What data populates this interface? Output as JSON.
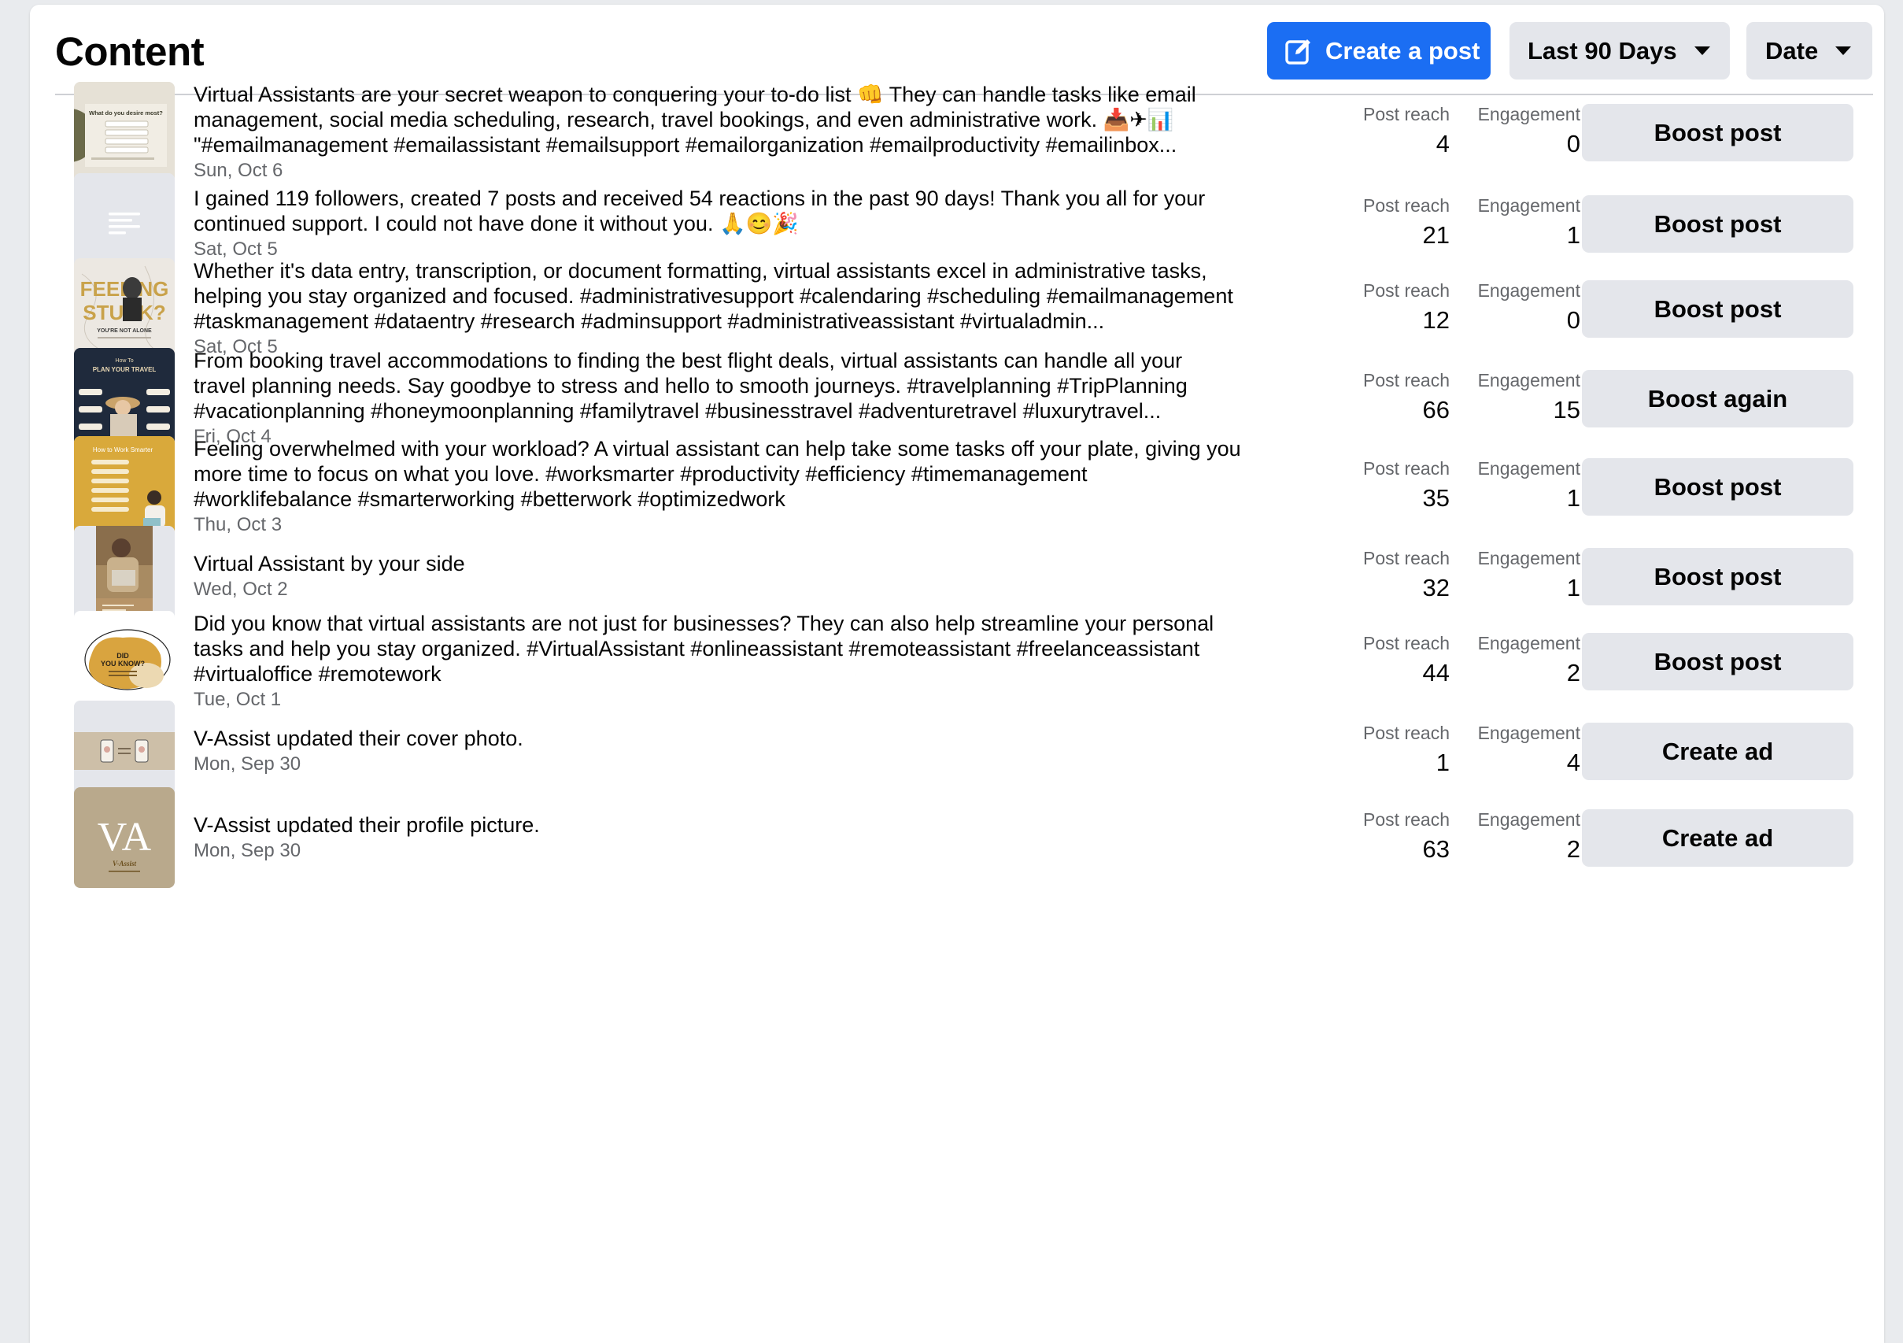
{
  "header": {
    "title": "Content",
    "create_label": "Create a post",
    "range_label": "Last 90 Days",
    "sort_label": "Date"
  },
  "colors": {
    "primary": "#1b6ef3",
    "secondary_button": "#e4e6eb",
    "muted_text": "#65676b"
  },
  "metric_labels": {
    "reach": "Post reach",
    "engagement": "Engagement"
  },
  "posts": [
    {
      "lines": [
        "Virtual Assistants are your secret weapon to conquering your to-do list 👊 They can handle tasks like email",
        "management, social media scheduling, research, travel bookings, and even administrative work. 📥✈📊",
        "\"#emailmanagement #emailassistant #emailsupport #emailorganization #emailproductivity #emailinbox..."
      ],
      "date": "Sun, Oct 6",
      "reach": "4",
      "engagement": "0",
      "action": "Boost post",
      "thumbnail": "email-tasks-graphic",
      "thumb_text": "What do you desire most?"
    },
    {
      "lines": [
        "I gained 119 followers, created 7 posts and received 54 reactions in the past 90 days! Thank you all for your",
        "continued support. I could not have done it without you. 🙏😊🎉"
      ],
      "date": "Sat, Oct 5",
      "reach": "21",
      "engagement": "1",
      "action": "Boost post",
      "thumbnail": "text-post-icon",
      "thumb_text": ""
    },
    {
      "lines": [
        "Whether it's data entry, transcription, or document formatting, virtual assistants excel in administrative tasks,",
        "helping you stay organized and focused. #administrativesupport #calendaring #scheduling #emailmanagement",
        "#taskmanagement #dataentry #research #adminsupport #administrativeassistant #virtualadmin..."
      ],
      "date": "Sat, Oct 5",
      "reach": "12",
      "engagement": "0",
      "action": "Boost post",
      "thumbnail": "feeling-stuck-graphic",
      "thumb_text": "FEELING STUCK?",
      "thumb_subtext": "YOU'RE NOT ALONE"
    },
    {
      "lines": [
        "From booking travel accommodations to finding the best flight deals, virtual assistants can handle all your",
        "travel planning needs. Say goodbye to stress and hello to smooth journeys. #travelplanning #TripPlanning",
        "#vacationplanning #honeymoonplanning #familytravel #businesstravel #adventuretravel #luxurytravel..."
      ],
      "date": "Fri, Oct 4",
      "reach": "66",
      "engagement": "15",
      "action": "Boost again",
      "thumbnail": "plan-your-travel-graphic",
      "thumb_text": "How To",
      "thumb_subtext": "PLAN YOUR TRAVEL"
    },
    {
      "lines": [
        "Feeling overwhelmed with your workload? A virtual assistant can help take some tasks off your plate, giving you",
        "more time to focus on what you love. #worksmarter #productivity #efficiency #timemanagement",
        "#worklifebalance #smarterworking #betterwork #optimizedwork"
      ],
      "date": "Thu, Oct 3",
      "reach": "35",
      "engagement": "1",
      "action": "Boost post",
      "thumbnail": "work-smarter-graphic",
      "thumb_text": "How to Work Smarter"
    },
    {
      "lines": [
        "Virtual Assistant by your side"
      ],
      "date": "Wed, Oct 2",
      "reach": "32",
      "engagement": "1",
      "action": "Boost post",
      "thumbnail": "assistant-photo",
      "thumb_text": ""
    },
    {
      "lines": [
        "Did you know that virtual assistants are not just for businesses? They can also help streamline your personal",
        "tasks and help you stay organized. #VirtualAssistant #onlineassistant #remoteassistant #freelanceassistant",
        "#virtualoffice #remotework"
      ],
      "date": "Tue, Oct 1",
      "reach": "44",
      "engagement": "2",
      "action": "Boost post",
      "thumbnail": "did-you-know-graphic",
      "thumb_text": "DID YOU KNOW?"
    },
    {
      "lines": [
        "V-Assist updated their cover photo."
      ],
      "date": "Mon, Sep 30",
      "reach": "1",
      "engagement": "4",
      "action": "Create ad",
      "thumbnail": "cover-photo",
      "thumb_text": ""
    },
    {
      "lines": [
        "V-Assist updated their profile picture."
      ],
      "date": "Mon, Sep 30",
      "reach": "63",
      "engagement": "2",
      "action": "Create ad",
      "thumbnail": "va-logo",
      "thumb_text": "VA",
      "thumb_subtext": "V-Assist"
    }
  ]
}
